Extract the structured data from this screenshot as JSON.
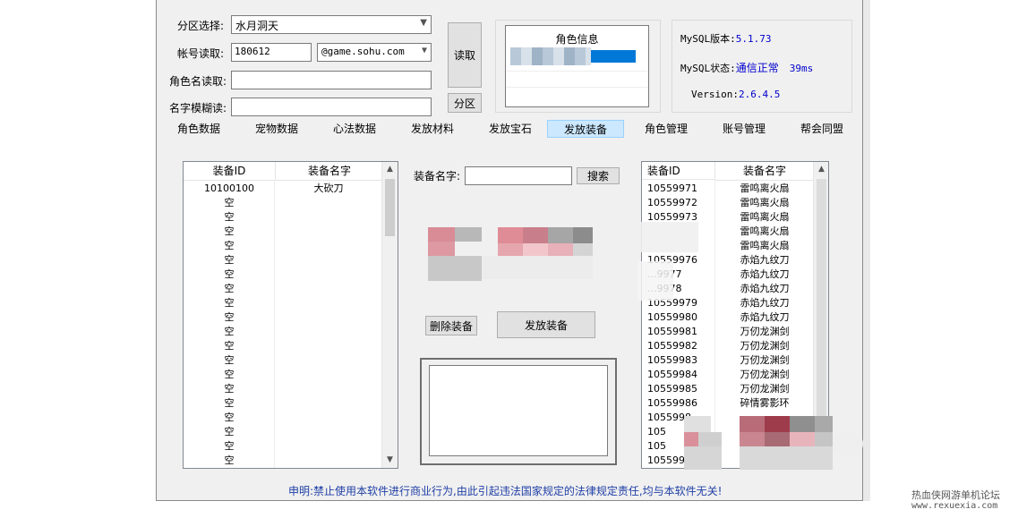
{
  "form": {
    "zone_label": "分区选择:",
    "zone_value": "水月洞天",
    "account_label": "帐号读取:",
    "account_value": "180612",
    "domain_value": "@game.sohu.com",
    "role_label": "角色名读取:",
    "role_value": "",
    "fuzzy_label": "名字模糊读:",
    "fuzzy_value": ""
  },
  "buttons": {
    "read": "读取",
    "zone": "分区",
    "search": "搜索",
    "delete_equip": "删除装备",
    "send_equip": "发放装备"
  },
  "role_info": {
    "title": "角色信息"
  },
  "status": {
    "mysql_version_label": "MySQL版本:",
    "mysql_version_value": "5.1.73",
    "mysql_status_label": "MySQL状态:",
    "mysql_status_value": "通信正常",
    "mysql_latency": "39ms",
    "version_label": "Version:",
    "version_value": "2.6.4.5"
  },
  "tabs": [
    {
      "label": "角色数据"
    },
    {
      "label": "宠物数据"
    },
    {
      "label": "心法数据"
    },
    {
      "label": "发放材料"
    },
    {
      "label": "发放宝石"
    },
    {
      "label": "发放装备"
    },
    {
      "label": "角色管理"
    },
    {
      "label": "账号管理"
    },
    {
      "label": "帮会同盟"
    }
  ],
  "active_tab": "发放装备",
  "left_list": {
    "col_id": "装备ID",
    "col_name": "装备名字",
    "rows": [
      {
        "id": "10100100",
        "name": "大砍刀"
      },
      {
        "id": "空",
        "name": ""
      },
      {
        "id": "空",
        "name": ""
      },
      {
        "id": "空",
        "name": ""
      },
      {
        "id": "空",
        "name": ""
      },
      {
        "id": "空",
        "name": ""
      },
      {
        "id": "空",
        "name": ""
      },
      {
        "id": "空",
        "name": ""
      },
      {
        "id": "空",
        "name": ""
      },
      {
        "id": "空",
        "name": ""
      },
      {
        "id": "空",
        "name": ""
      },
      {
        "id": "空",
        "name": ""
      },
      {
        "id": "空",
        "name": ""
      },
      {
        "id": "空",
        "name": ""
      },
      {
        "id": "空",
        "name": ""
      },
      {
        "id": "空",
        "name": ""
      },
      {
        "id": "空",
        "name": ""
      },
      {
        "id": "空",
        "name": ""
      },
      {
        "id": "空",
        "name": ""
      },
      {
        "id": "空",
        "name": ""
      }
    ]
  },
  "search": {
    "label": "装备名字:",
    "value": ""
  },
  "right_list": {
    "col_id": "装备ID",
    "col_name": "装备名字",
    "rows": [
      {
        "id": "10559971",
        "name": "雷鸣离火扇"
      },
      {
        "id": "10559972",
        "name": "雷鸣离火扇"
      },
      {
        "id": "10559973",
        "name": "雷鸣离火扇"
      },
      {
        "id": "",
        "name": "雷鸣离火扇"
      },
      {
        "id": "",
        "name": "雷鸣离火扇"
      },
      {
        "id": "10559976",
        "name": "赤焰九纹刀"
      },
      {
        "id": "...9977",
        "name": "赤焰九纹刀"
      },
      {
        "id": "...9978",
        "name": "赤焰九纹刀"
      },
      {
        "id": "10559979",
        "name": "赤焰九纹刀"
      },
      {
        "id": "10559980",
        "name": "赤焰九纹刀"
      },
      {
        "id": "10559981",
        "name": "万仞龙渊剑"
      },
      {
        "id": "10559982",
        "name": "万仞龙渊剑"
      },
      {
        "id": "10559983",
        "name": "万仞龙渊剑"
      },
      {
        "id": "10559984",
        "name": "万仞龙渊剑"
      },
      {
        "id": "10559985",
        "name": "万仞龙渊剑"
      },
      {
        "id": "10559986",
        "name": "碎情雾影环"
      },
      {
        "id": "1055998",
        "name": ""
      },
      {
        "id": "105",
        "name": ""
      },
      {
        "id": "105",
        "name": ""
      },
      {
        "id": "10559990",
        "name": ""
      }
    ]
  },
  "footer": "申明:禁止使用本软件进行商业行为,由此引起违法国家规定的法律规定责任,均与本软件无关!",
  "watermark": {
    "line1": "热血侠网游单机论坛",
    "line2": "www.rexuexia.com"
  },
  "colors": {
    "active_tab_bg": "#cce8ff",
    "progress": "#0078d7",
    "status_ok": "#0000cc",
    "footer_text": "#1f3fa6"
  }
}
